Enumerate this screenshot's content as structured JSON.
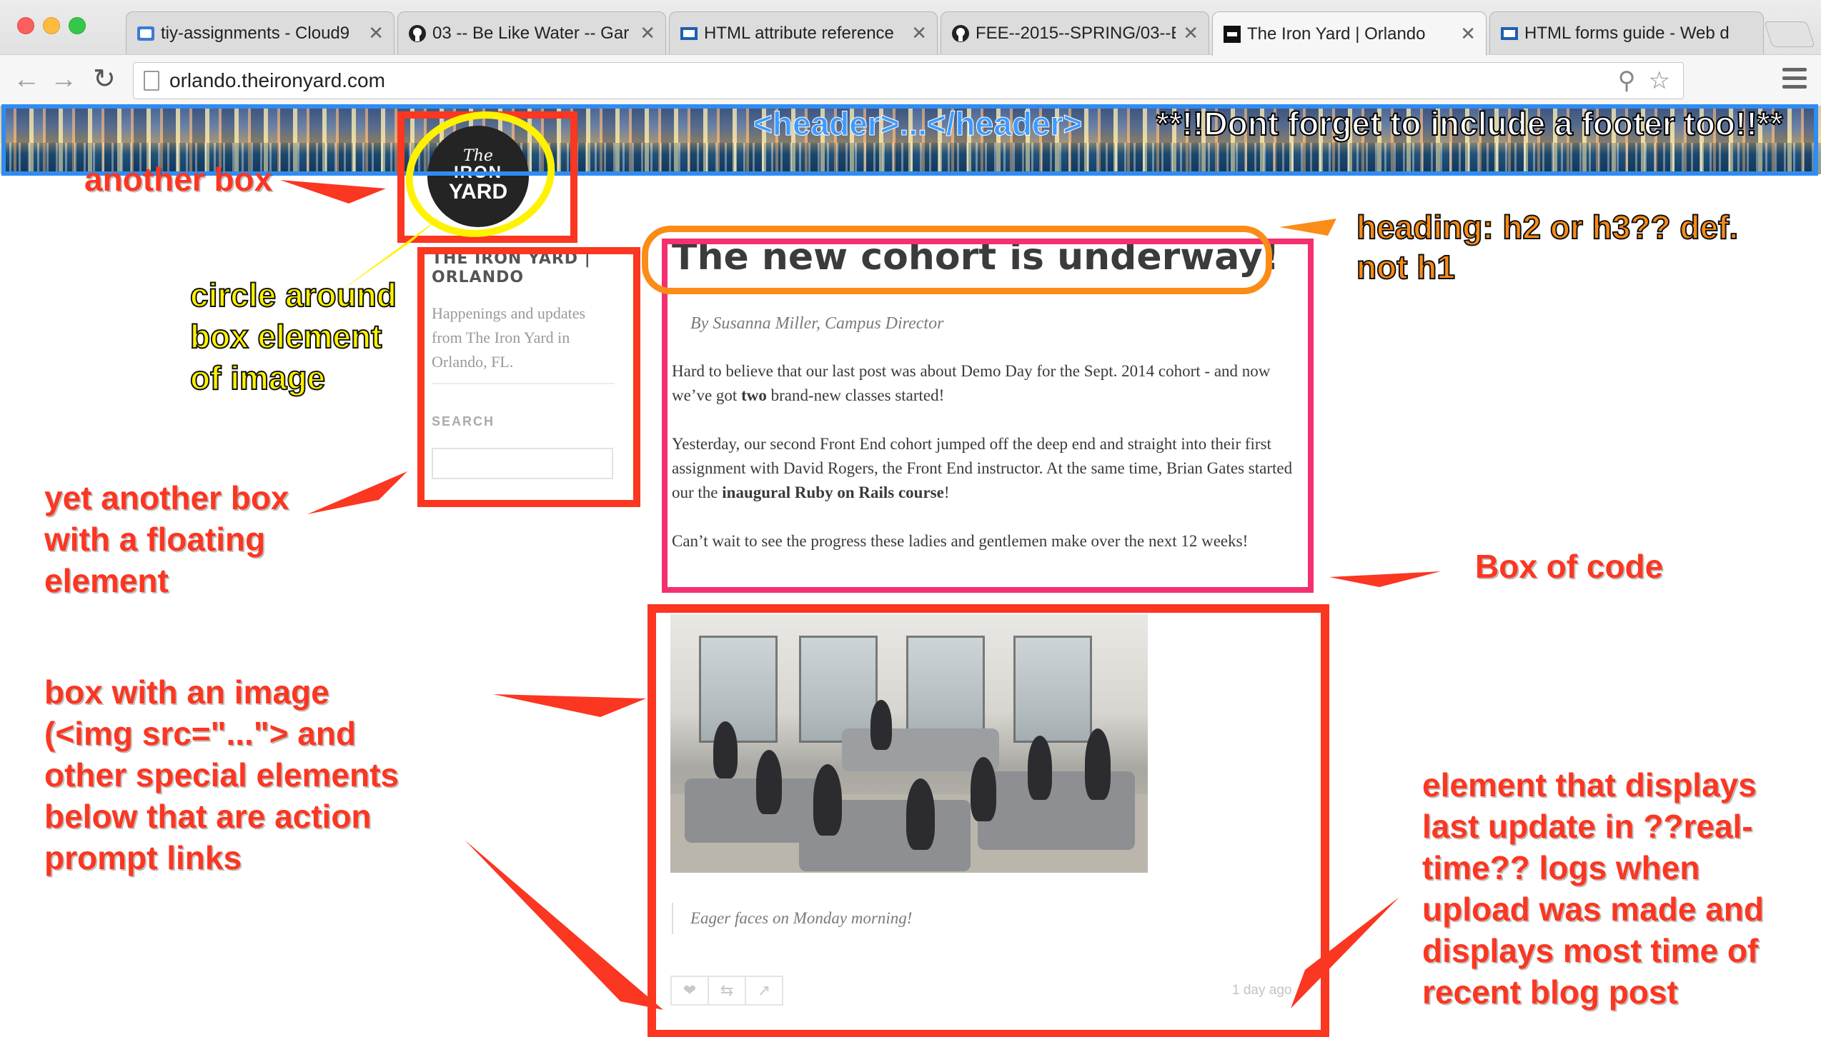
{
  "browser": {
    "tabs": [
      {
        "title": "tiy-assignments - Cloud9",
        "icon": "cloud9-icon",
        "active": false
      },
      {
        "title": "03 -- Be Like Water -- Gar",
        "icon": "github-icon",
        "active": false
      },
      {
        "title": "HTML attribute reference",
        "icon": "mdn-icon",
        "active": false
      },
      {
        "title": "FEE--2015--SPRING/03--E",
        "icon": "github-icon",
        "active": false
      },
      {
        "title": "The Iron Yard | Orlando",
        "icon": "iron-yard-icon",
        "active": true
      },
      {
        "title": "HTML forms guide - Web d",
        "icon": "mdn-icon",
        "active": false
      }
    ],
    "close_glyph": "✕",
    "url": "orlando.theironyard.com"
  },
  "site": {
    "logo": {
      "line1": "The",
      "line2": "IRON",
      "line3": "YARD"
    },
    "title": "THE IRON YARD | ORLANDO",
    "description": "Happenings and updates from The Iron Yard in Orlando, FL.",
    "search_label": "SEARCH"
  },
  "post": {
    "title": "The new cohort is underway!",
    "byline": "By Susanna Miller, Campus Director",
    "p1_before": "Hard to believe that our last post was about Demo Day for the Sept. 2014 cohort - and now we’ve got ",
    "p1_bold": "two",
    "p1_after": " brand-new classes started!",
    "p2_before": "Yesterday, our second Front End cohort jumped off the deep end and straight into their first assignment with David Rogers, the Front End instructor. At the same time, Brian Gates started our the ",
    "p2_bold": "inaugural Ruby on Rails course",
    "p2_after": "!",
    "p3": "Can’t wait to see the progress these ladies and gentlemen make over the next 12 weeks!",
    "caption": "Eager faces on Monday morning!",
    "timestamp": "1 day ago",
    "action_icons": [
      "heart-icon",
      "reblog-icon",
      "share-icon"
    ]
  },
  "annotations": {
    "header_label": "<header>...</header>",
    "footer_note": "**!!Dont forget to include a footer too!!**",
    "another_box": "another box",
    "circle_note": "circle around\nbox element\nof image",
    "heading_note": "heading: h2 or h3?? def.\nnot h1",
    "yet_another_box": "yet another box\nwith a floating\nelement",
    "box_of_code": "Box of code",
    "image_box_note": "box with an image\n(<img src=\"...\"> and\nother special elements\nbelow that are action\nprompt links",
    "timestamp_note": "element that displays\nlast update in ??real-\ntime?? logs when\nupload was made and\ndisplays most time of\nrecent blog post"
  },
  "colors": {
    "annotation_red": "#fb3621",
    "annotation_pink": "#f4306e",
    "annotation_blue": "#2f8cf4",
    "annotation_yellow": "#fff200",
    "annotation_orange": "#fb8c17"
  }
}
